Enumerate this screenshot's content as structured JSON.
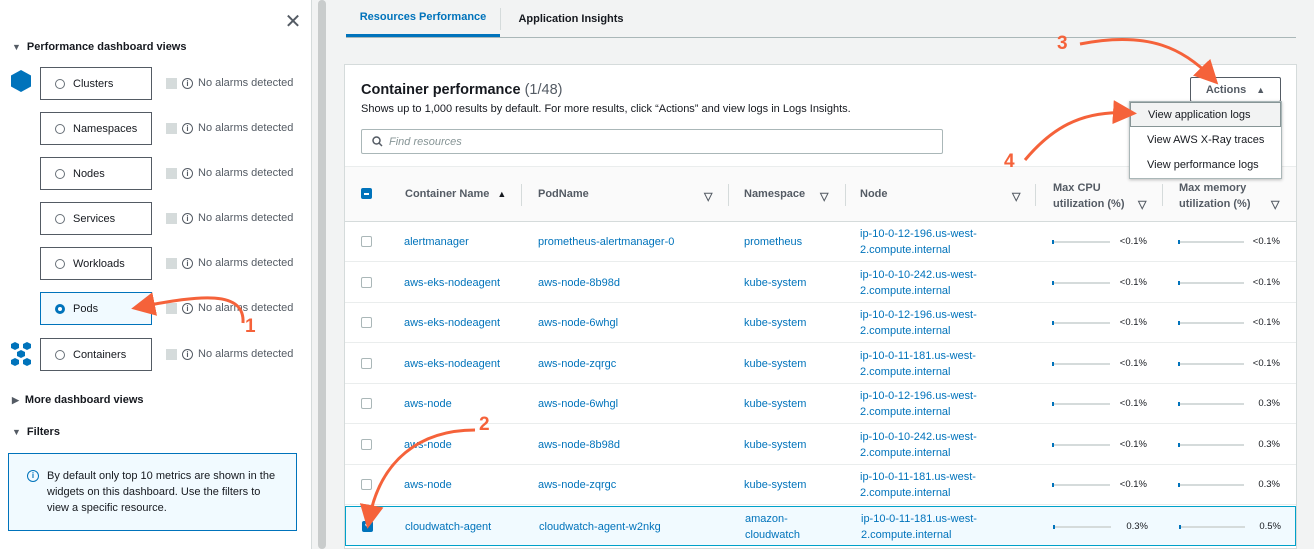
{
  "left_panel": {
    "close_icon": "close-icon",
    "perf_views_heading": "Performance dashboard views",
    "resources": [
      {
        "label": "Clusters",
        "alarm": "No alarms detected",
        "selected": false
      },
      {
        "label": "Namespaces",
        "alarm": "No alarms detected",
        "selected": false
      },
      {
        "label": "Nodes",
        "alarm": "No alarms detected",
        "selected": false
      },
      {
        "label": "Services",
        "alarm": "No alarms detected",
        "selected": false
      },
      {
        "label": "Workloads",
        "alarm": "No alarms detected",
        "selected": false
      },
      {
        "label": "Pods",
        "alarm": "No alarms detected",
        "selected": true
      },
      {
        "label": "Containers",
        "alarm": "No alarms detected",
        "selected": false
      }
    ],
    "more_views": "More dashboard views",
    "filters": "Filters",
    "info_text": "By default only top 10 metrics are shown in the widgets on this dashboard. Use the filters to view a specific resource."
  },
  "tabs": [
    {
      "label": "Resources Performance",
      "active": true
    },
    {
      "label": "Application Insights",
      "active": false
    }
  ],
  "panel": {
    "title": "Container performance",
    "count": "(1/48)",
    "subtitle": "Shows up to 1,000 results by default. For more results, click “Actions” and view logs in Logs Insights.",
    "search_placeholder": "Find resources",
    "actions_label": "Actions",
    "menu": [
      "View application logs",
      "View AWS X-Ray traces",
      "View performance logs"
    ]
  },
  "table": {
    "columns": [
      "Container Name",
      "PodName",
      "Namespace",
      "Node",
      "Max CPU utilization (%)",
      "Max memory utilization (%)"
    ],
    "rows": [
      {
        "container": "alertmanager",
        "pod": "prometheus-alertmanager-0",
        "namespace": "prometheus",
        "node": "ip-10-0-12-196.us-west-2.compute.internal",
        "cpu": "<0.1%",
        "mem": "<0.1%",
        "checked": false
      },
      {
        "container": "aws-eks-nodeagent",
        "pod": "aws-node-8b98d",
        "namespace": "kube-system",
        "node": "ip-10-0-10-242.us-west-2.compute.internal",
        "cpu": "<0.1%",
        "mem": "<0.1%",
        "checked": false
      },
      {
        "container": "aws-eks-nodeagent",
        "pod": "aws-node-6whgl",
        "namespace": "kube-system",
        "node": "ip-10-0-12-196.us-west-2.compute.internal",
        "cpu": "<0.1%",
        "mem": "<0.1%",
        "checked": false
      },
      {
        "container": "aws-eks-nodeagent",
        "pod": "aws-node-zqrgc",
        "namespace": "kube-system",
        "node": "ip-10-0-11-181.us-west-2.compute.internal",
        "cpu": "<0.1%",
        "mem": "<0.1%",
        "checked": false
      },
      {
        "container": "aws-node",
        "pod": "aws-node-6whgl",
        "namespace": "kube-system",
        "node": "ip-10-0-12-196.us-west-2.compute.internal",
        "cpu": "<0.1%",
        "mem": "0.3%",
        "checked": false
      },
      {
        "container": "aws-node",
        "pod": "aws-node-8b98d",
        "namespace": "kube-system",
        "node": "ip-10-0-10-242.us-west-2.compute.internal",
        "cpu": "<0.1%",
        "mem": "0.3%",
        "checked": false
      },
      {
        "container": "aws-node",
        "pod": "aws-node-zqrgc",
        "namespace": "kube-system",
        "node": "ip-10-0-11-181.us-west-2.compute.internal",
        "cpu": "<0.1%",
        "mem": "0.3%",
        "checked": false
      },
      {
        "container": "cloudwatch-agent",
        "pod": "cloudwatch-agent-w2nkg",
        "namespace": "amazon-cloudwatch",
        "node": "ip-10-0-11-181.us-west-2.compute.internal",
        "cpu": "0.3%",
        "mem": "0.5%",
        "checked": true
      }
    ]
  },
  "annotations": [
    "1",
    "2",
    "3",
    "4"
  ],
  "colors": {
    "accent": "#0073bb",
    "annotation": "#f5623a"
  }
}
